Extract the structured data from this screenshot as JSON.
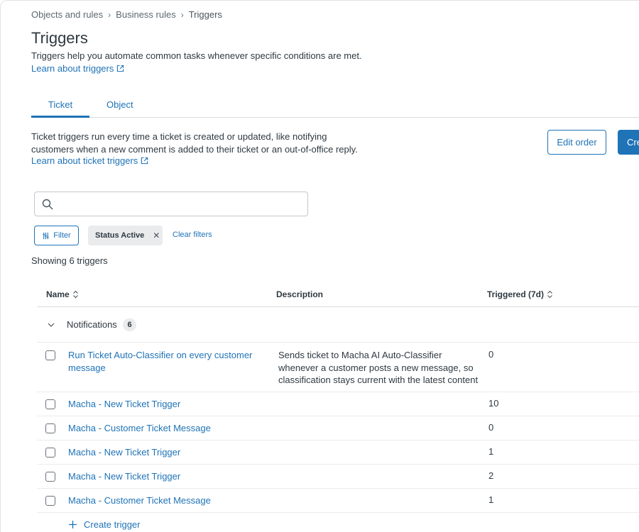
{
  "breadcrumb": {
    "items": [
      "Objects and rules",
      "Business rules"
    ],
    "current": "Triggers"
  },
  "page": {
    "title": "Triggers",
    "description": "Triggers help you automate common tasks whenever specific conditions are met.",
    "learn_link": "Learn about triggers"
  },
  "tabs": [
    {
      "label": "Ticket",
      "selected": true
    },
    {
      "label": "Object",
      "selected": false
    }
  ],
  "ticket_section": {
    "description": "Ticket triggers run every time a ticket is created or updated, like notifying customers when a new comment is added to their ticket or an out-of-office reply.",
    "learn_link": "Learn about ticket triggers"
  },
  "actions": {
    "edit_order": "Edit order",
    "create": "Cre"
  },
  "search": {
    "placeholder": "",
    "value": ""
  },
  "filters": {
    "filter_label": "Filter",
    "active_chip": "Status Active",
    "clear_label": "Clear filters"
  },
  "showing": "Showing 6 triggers",
  "table": {
    "headers": {
      "name": "Name",
      "description": "Description",
      "triggered": "Triggered (7d)"
    },
    "group": {
      "label": "Notifications",
      "count": "6"
    },
    "rows": [
      {
        "name": "Run Ticket Auto-Classifier on every customer message",
        "description": "Sends ticket to Macha AI Auto-Classifier whenever a customer posts a new message, so classification stays current with the latest content",
        "triggered": "0"
      },
      {
        "name": "Macha - New Ticket Trigger",
        "description": "",
        "triggered": "10"
      },
      {
        "name": "Macha - Customer Ticket Message",
        "description": "",
        "triggered": "0"
      },
      {
        "name": "Macha - New Ticket Trigger",
        "description": "",
        "triggered": "1"
      },
      {
        "name": "Macha - New Ticket Trigger",
        "description": "",
        "triggered": "2"
      },
      {
        "name": "Macha - Customer Ticket Message",
        "description": "",
        "triggered": "1"
      }
    ]
  },
  "create_trigger": "Create trigger",
  "colors": {
    "accent": "#1f73b7",
    "text": "#2f3941",
    "border": "#d8dcde",
    "chip_bg": "#e9ebed"
  }
}
